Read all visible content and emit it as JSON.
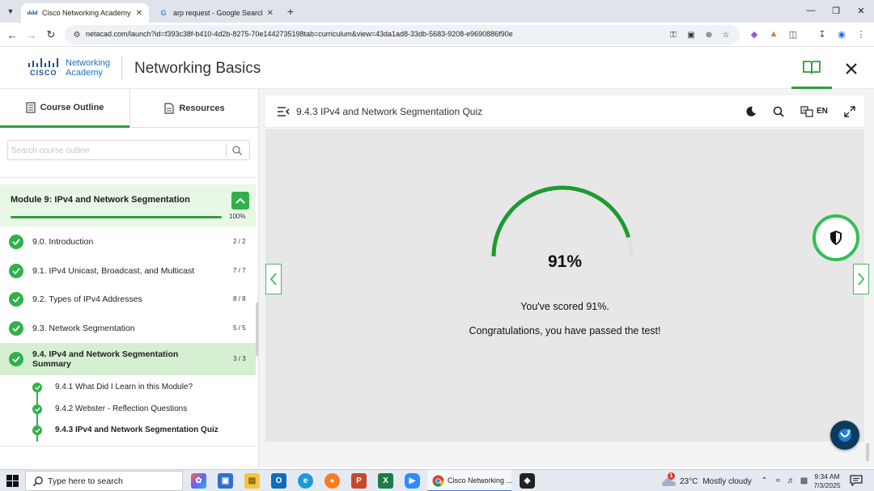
{
  "browser": {
    "tabs": [
      {
        "title": "Cisco Networking Academy: Co",
        "favicon": "cisco-icon",
        "active": true
      },
      {
        "title": "arp request - Google Search",
        "favicon": "google-icon",
        "active": false
      }
    ],
    "url": "netacad.com/launch?id=f393c38f-b410-4d2b-8275-70e1442735198tab=curriculum&view=43da1ad8-33db-5683-9208-e9690886f90e"
  },
  "header": {
    "brand_line1": "Networking",
    "brand_line2": "Academy",
    "cisco_word": "CISCO",
    "course_title": "Networking Basics"
  },
  "sidebar": {
    "tabs": [
      {
        "label": "Course Outline",
        "icon": "outline-icon",
        "active": true
      },
      {
        "label": "Resources",
        "icon": "document-icon",
        "active": false
      }
    ],
    "search_placeholder": "Search course outline",
    "module": {
      "title": "Module 9: IPv4 and Network Segmentation",
      "progress_label": "100%",
      "progress": 100
    },
    "lessons": [
      {
        "label": "9.0. Introduction",
        "count": "2 / 2"
      },
      {
        "label": "9.1. IPv4 Unicast, Broadcast, and Multicast",
        "count": "7 / 7"
      },
      {
        "label": "9.2. Types of IPv4 Addresses",
        "count": "8 / 8"
      },
      {
        "label": "9.3. Network Segmentation",
        "count": "5 / 5"
      },
      {
        "label_line1": "9.4. IPv4 and Network Segmentation",
        "label_line2": "Summary",
        "count": "3 / 3"
      }
    ],
    "subitems": [
      {
        "label": "9.4.1 What Did I Learn in this Module?"
      },
      {
        "label": "9.4.2 Webster - Reflection Questions"
      },
      {
        "label": "9.4.3 IPv4 and Network Segmentation Quiz"
      }
    ]
  },
  "content": {
    "quiz_title": "9.4.3 IPv4 and Network Segmentation Quiz",
    "language": "EN",
    "score_label": "91%",
    "score": 91,
    "scored_message": "You've scored 91%.",
    "pass_message": "Congratulations, you have passed the test!"
  },
  "taskbar": {
    "search_placeholder": "Type here to search",
    "running_app": "Cisco Networking ...",
    "weather_temp": "23°C",
    "weather_condition": "Mostly cloudy",
    "time": "9:34 AM",
    "date": "7/3/2025",
    "notification_count": "1"
  },
  "colors": {
    "accent_green": "#2e9e3e",
    "check_green": "#2fb14a",
    "module_bg": "#e8f7e6",
    "current_bg": "#d4f0d0",
    "brand_blue": "#1a73c9"
  }
}
